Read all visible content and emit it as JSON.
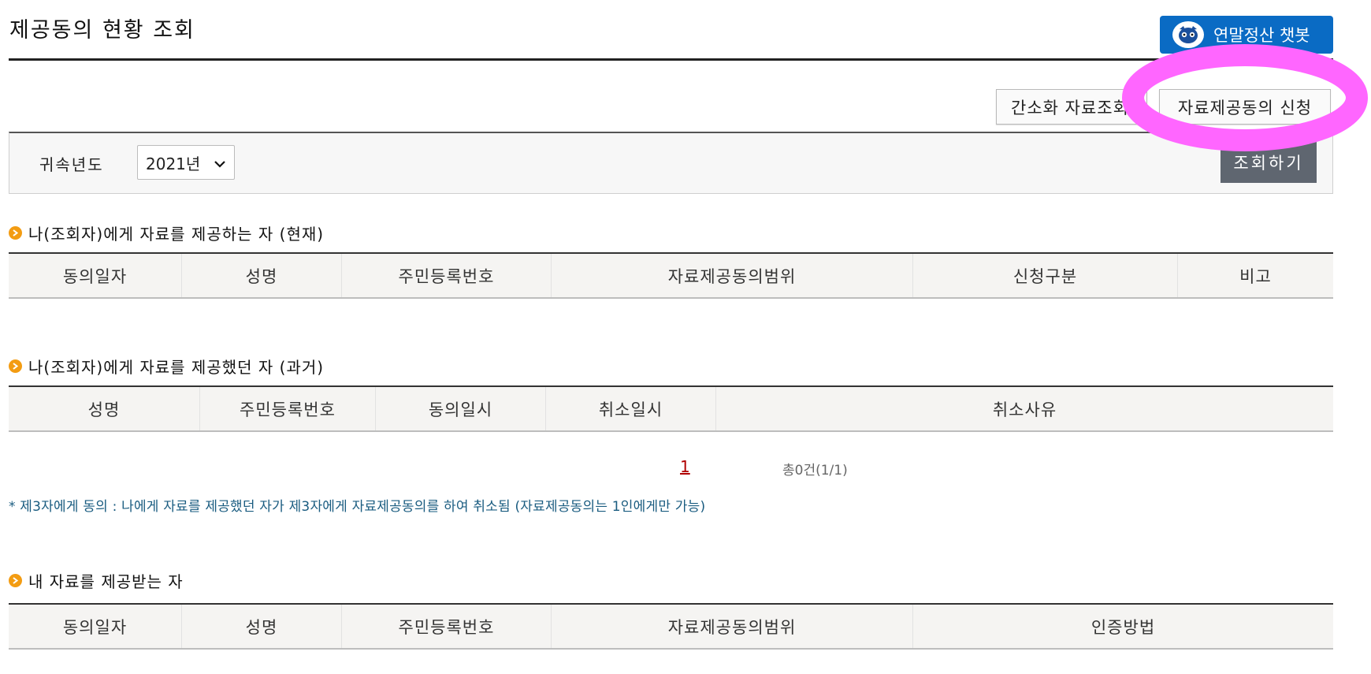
{
  "header": {
    "title": "제공동의 현황 조회",
    "chatbot_label": "연말정산 챗봇"
  },
  "toolbar": {
    "simplified_label": "간소화 자료조회",
    "consent_apply_label": "자료제공동의 신청"
  },
  "search": {
    "year_label": "귀속년도",
    "year_value": "2021년",
    "search_label": "조회하기"
  },
  "sections": {
    "current": {
      "title": "나(조회자)에게 자료를 제공하는 자 (현재)",
      "columns": [
        "동의일자",
        "성명",
        "주민등록번호",
        "자료제공동의범위",
        "신청구분",
        "비고"
      ]
    },
    "past": {
      "title": "나(조회자)에게 자료를 제공했던 자 (과거)",
      "columns": [
        "성명",
        "주민등록번호",
        "동의일시",
        "취소일시",
        "취소사유"
      ],
      "page": "1",
      "total": "총0건(1/1)",
      "note": "* 제3자에게 동의 : 나에게 자료를 제공했던 자가 제3자에게 자료제공동의를 하여 취소됨 (자료제공동의는 1인에게만 가능)"
    },
    "recipients": {
      "title": "내 자료를 제공받는 자",
      "columns": [
        "동의일자",
        "성명",
        "주민등록번호",
        "자료제공동의범위",
        "인증방법"
      ]
    }
  },
  "colors": {
    "chatbot": "#0a6bc4",
    "highlight": "#ff66ff",
    "bullet": "#f39c12",
    "note": "#1a5c80",
    "pager": "#b00000"
  },
  "icons": [
    "chatbot-icon",
    "chevron-down-icon",
    "bullet-arrow-icon"
  ]
}
